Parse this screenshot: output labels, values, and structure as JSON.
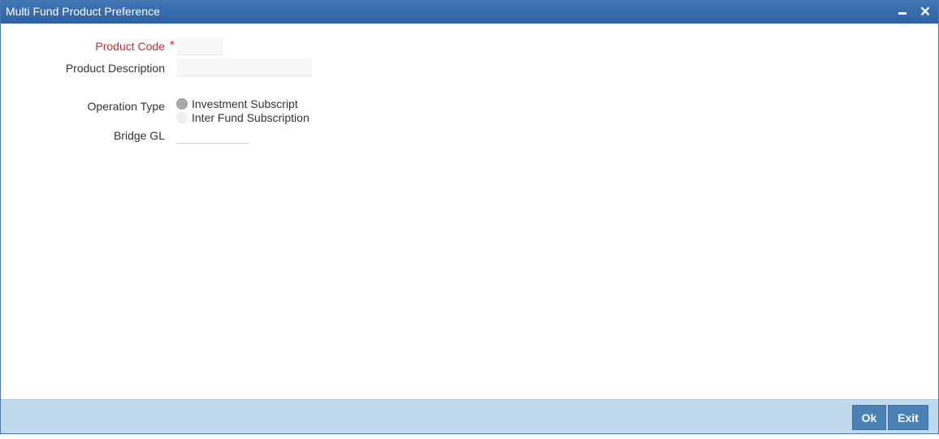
{
  "window": {
    "title": "Multi Fund Product Preference",
    "minimize_icon": "minimize-icon",
    "close_icon": "close-icon",
    "close_glyph": "✕"
  },
  "form": {
    "product_code": {
      "label": "Product Code",
      "required_marker": "*",
      "value": ""
    },
    "product_description": {
      "label": "Product Description",
      "value": ""
    },
    "operation_type": {
      "label": "Operation Type",
      "options": [
        {
          "label": "Investment Subscript",
          "selected": true
        },
        {
          "label": "Inter Fund Subscription",
          "selected": false
        }
      ]
    },
    "bridge_gl": {
      "label": "Bridge GL",
      "value": ""
    }
  },
  "footer": {
    "ok_label": "Ok",
    "exit_label": "Exit"
  },
  "colors": {
    "titlebar": "#3366aa",
    "required": "#d22a2a",
    "footer": "#c1d9ec",
    "button": "#4a81b6"
  }
}
